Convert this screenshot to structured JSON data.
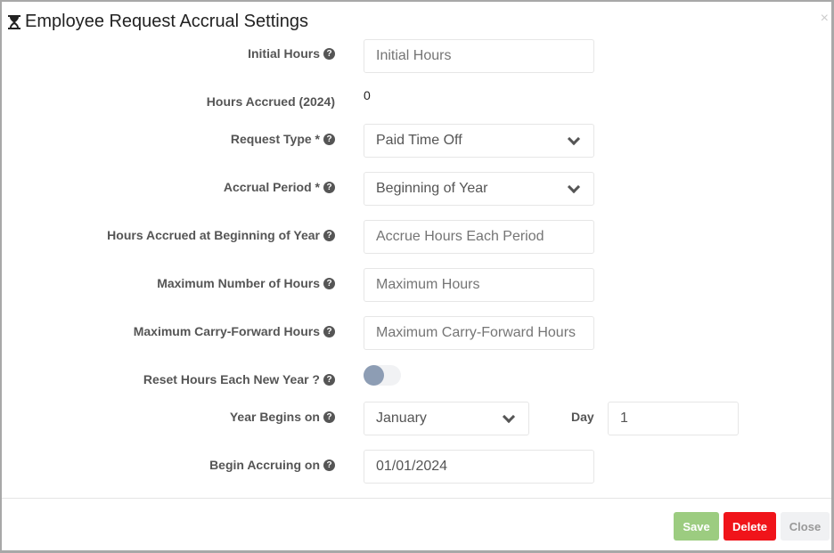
{
  "title": "Employee Request Accrual Settings",
  "close_icon": "×",
  "fields": {
    "initial_hours": {
      "label": "Initial Hours",
      "placeholder": "Initial Hours"
    },
    "hours_accrued": {
      "label": "Hours Accrued (2024)",
      "value": "0"
    },
    "request_type": {
      "label": "Request Type *",
      "value": "Paid Time Off"
    },
    "accrual_period": {
      "label": "Accrual Period *",
      "value": "Beginning of Year"
    },
    "hours_beginning": {
      "label": "Hours Accrued at Beginning of Year",
      "placeholder": "Accrue Hours Each Period"
    },
    "max_hours": {
      "label": "Maximum Number of Hours",
      "placeholder": "Maximum Hours"
    },
    "max_carry": {
      "label": "Maximum Carry-Forward Hours",
      "placeholder": "Maximum Carry-Forward Hours"
    },
    "reset": {
      "label": "Reset Hours Each New Year ?",
      "on": false
    },
    "year_begins": {
      "label": "Year Begins on",
      "value": "January",
      "day_label": "Day",
      "day_value": "1"
    },
    "begin_accruing": {
      "label": "Begin Accruing on",
      "value": "01/01/2024"
    }
  },
  "buttons": {
    "save": "Save",
    "delete": "Delete",
    "close": "Close"
  },
  "colors": {
    "save": "#9ccc80",
    "delete": "#f0141a",
    "close": "#f0f1f3"
  }
}
